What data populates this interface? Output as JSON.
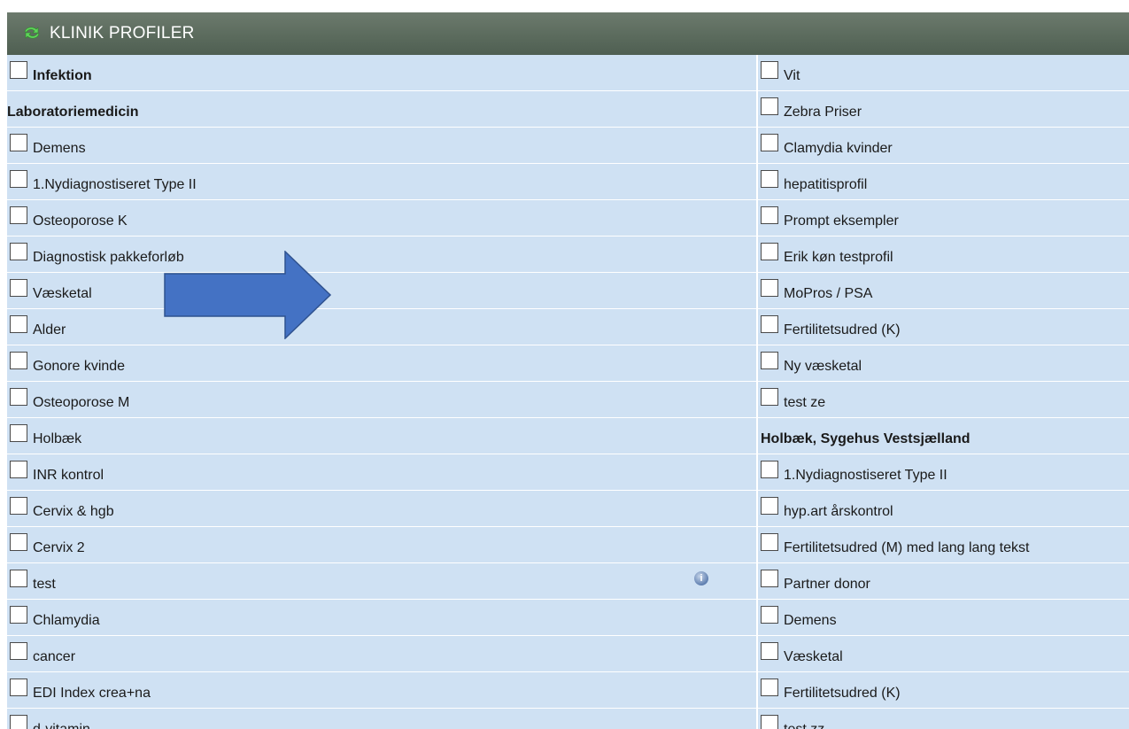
{
  "header": {
    "title": "KLINIK PROFILER",
    "icon": "refresh-arrows-icon",
    "bg": "#5a6a5c"
  },
  "colors": {
    "body": "#cfe1f3",
    "arrow": "#4472c4"
  },
  "left_column": [
    {
      "kind": "check",
      "label": "Infektion",
      "bold": true
    },
    {
      "kind": "group",
      "label": "Laboratoriemedicin"
    },
    {
      "kind": "check",
      "label": "Demens"
    },
    {
      "kind": "check",
      "label": "1.Nydiagnostiseret Type II"
    },
    {
      "kind": "check",
      "label": "Osteoporose K"
    },
    {
      "kind": "check",
      "label": "Diagnostisk pakkeforløb"
    },
    {
      "kind": "check",
      "label": "Væsketal"
    },
    {
      "kind": "check",
      "label": "Alder"
    },
    {
      "kind": "check",
      "label": "Gonore kvinde"
    },
    {
      "kind": "check",
      "label": "Osteoporose M"
    },
    {
      "kind": "check",
      "label": "Holbæk"
    },
    {
      "kind": "check",
      "label": "INR kontrol"
    },
    {
      "kind": "check",
      "label": "Cervix & hgb"
    },
    {
      "kind": "check",
      "label": "Cervix 2"
    },
    {
      "kind": "check",
      "label": "test",
      "info": true
    },
    {
      "kind": "check",
      "label": "Chlamydia"
    },
    {
      "kind": "check",
      "label": "cancer"
    },
    {
      "kind": "check",
      "label": "EDI Index crea+na"
    },
    {
      "kind": "check",
      "label": "d-vitamin"
    }
  ],
  "right_column": [
    {
      "kind": "check",
      "label": "Vit"
    },
    {
      "kind": "check",
      "label": "Zebra Priser"
    },
    {
      "kind": "check",
      "label": "Clamydia kvinder"
    },
    {
      "kind": "check",
      "label": "hepatitisprofil"
    },
    {
      "kind": "check",
      "label": "Prompt eksempler"
    },
    {
      "kind": "check",
      "label": "Erik køn testprofil"
    },
    {
      "kind": "check",
      "label": "MoPros / PSA"
    },
    {
      "kind": "check",
      "label": "Fertilitetsudred (K)"
    },
    {
      "kind": "check",
      "label": "Ny væsketal"
    },
    {
      "kind": "check",
      "label": "test ze"
    },
    {
      "kind": "group",
      "label": "Holbæk, Sygehus Vestsjælland"
    },
    {
      "kind": "check",
      "label": "1.Nydiagnostiseret Type II"
    },
    {
      "kind": "check",
      "label": "hyp.art årskontrol"
    },
    {
      "kind": "check",
      "label": "Fertilitetsudred (M) med lang lang tekst"
    },
    {
      "kind": "check",
      "label": "Partner donor"
    },
    {
      "kind": "check",
      "label": "Demens"
    },
    {
      "kind": "check",
      "label": "Væsketal"
    },
    {
      "kind": "check",
      "label": "Fertilitetsudred (K)"
    },
    {
      "kind": "check",
      "label": "test zz"
    }
  ]
}
